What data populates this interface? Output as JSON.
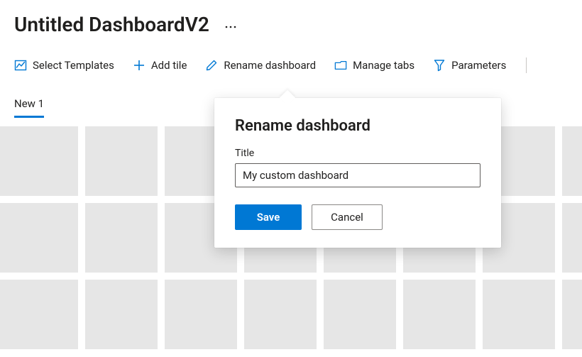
{
  "header": {
    "title": "Untitled DashboardV2"
  },
  "toolbar": {
    "select_templates": "Select Templates",
    "add_tile": "Add tile",
    "rename_dashboard": "Rename dashboard",
    "manage_tabs": "Manage tabs",
    "parameters": "Parameters"
  },
  "tabs": {
    "items": [
      {
        "label": "New 1",
        "active": true
      }
    ]
  },
  "dialog": {
    "title": "Rename dashboard",
    "field_label": "Title",
    "input_value": "My custom dashboard",
    "save_label": "Save",
    "cancel_label": "Cancel"
  },
  "colors": {
    "accent": "#0078d4"
  }
}
